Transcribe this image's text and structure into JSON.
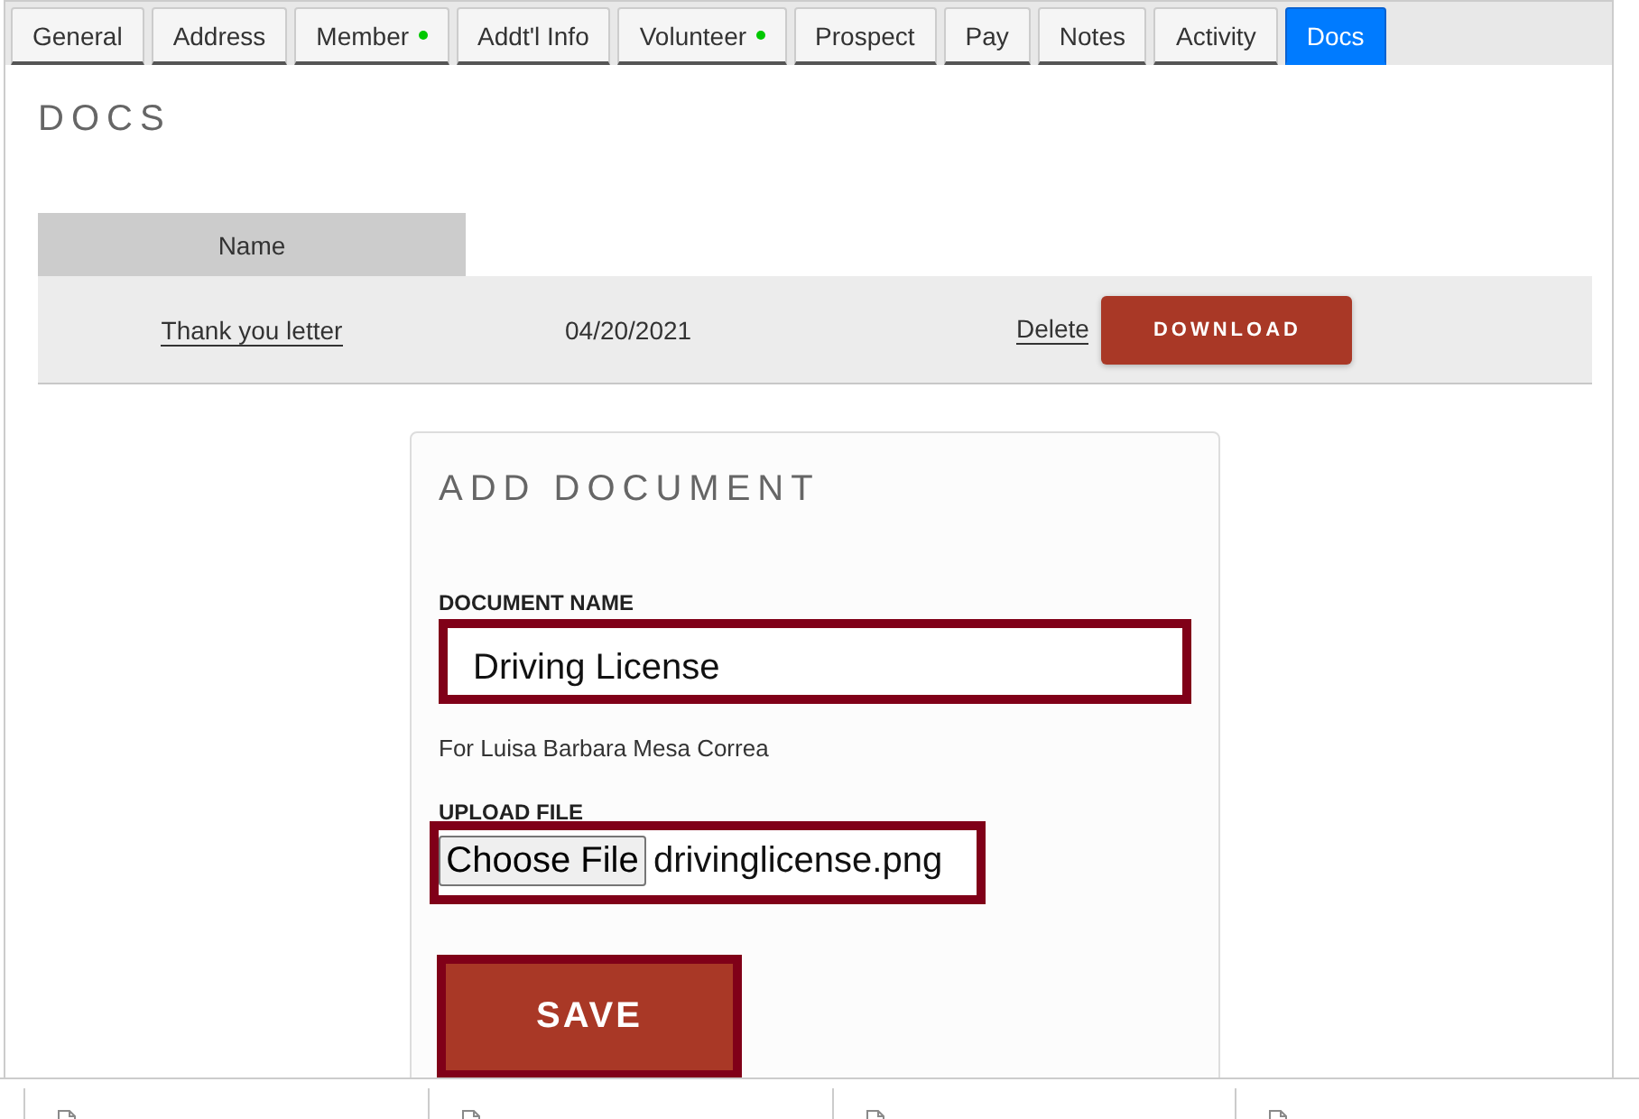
{
  "tabs": [
    {
      "label": "General",
      "selected": false,
      "status_dot": false
    },
    {
      "label": "Address",
      "selected": false,
      "status_dot": false
    },
    {
      "label": "Member",
      "selected": false,
      "status_dot": true
    },
    {
      "label": "Addt'l Info",
      "selected": false,
      "status_dot": false
    },
    {
      "label": "Volunteer",
      "selected": false,
      "status_dot": true
    },
    {
      "label": "Prospect",
      "selected": false,
      "status_dot": false
    },
    {
      "label": "Pay",
      "selected": false,
      "status_dot": false
    },
    {
      "label": "Notes",
      "selected": false,
      "status_dot": false
    },
    {
      "label": "Activity",
      "selected": false,
      "status_dot": false
    },
    {
      "label": "Docs",
      "selected": true,
      "status_dot": false
    }
  ],
  "page": {
    "title": "DOCS"
  },
  "table": {
    "columns": [
      "Name"
    ],
    "rows": [
      {
        "name": "Thank you letter",
        "column_2": "04/20/2021",
        "delete": "Delete",
        "download": "DOWNLOAD"
      }
    ]
  },
  "add_document": {
    "title": "ADD DOCUMENT",
    "document_name": {
      "label": "DOCUMENT NAME",
      "value": "Driving License",
      "highlighted": true
    },
    "owner_note": "For Luisa Barbara Mesa Correa",
    "upload_file": {
      "label": "UPLOAD FILE",
      "button": "Choose File",
      "file_name": "drivinglicense.png",
      "highlighted": true
    },
    "save": {
      "label": "SAVE",
      "highlighted": true
    }
  }
}
